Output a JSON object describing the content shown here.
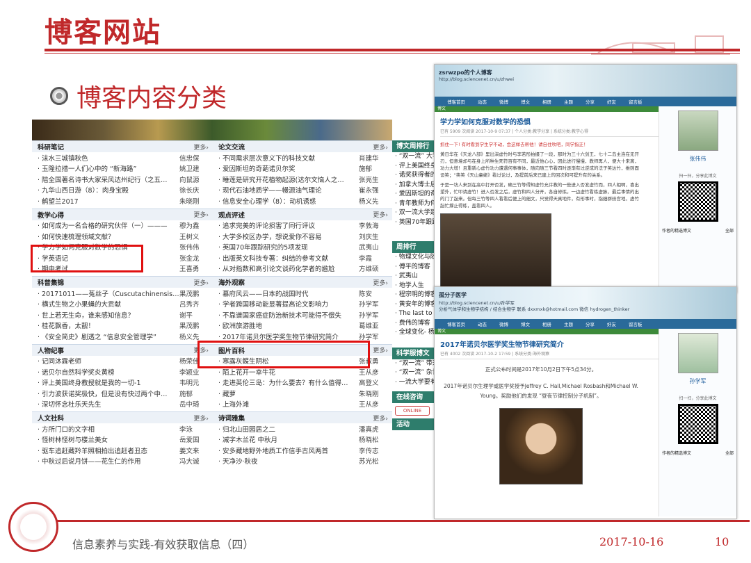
{
  "slide": {
    "title": "博客网站",
    "subtitle": "博客内容分类",
    "footer_text": "信息素养与实践-有效获取信息（四）",
    "footer_date": "2017-10-16",
    "page_number": "10"
  },
  "colors": {
    "accent": "#c0282a",
    "section_header": "#ecf1f7",
    "highlight_box": "#e01010"
  },
  "blog": {
    "sections_left": [
      {
        "name": "科研笔记",
        "more": "更多›",
        "rows": [
          [
            "· 沫水三城镇秋色",
            "信忠保"
          ],
          [
            "· 玉隆拉措一人们心中的 “新海路”",
            "姚卫建"
          ],
          [
            "· 陪全国著名诗书大家采风达州纪行（之五…",
            "向鼠源"
          ],
          [
            "· 九华山西日游（8）：肉身宝殿",
            "徐长庆"
          ],
          [
            "· 鹤望兰2017",
            "朱晓刚"
          ]
        ]
      },
      {
        "name": "教学心得",
        "more": "更多›",
        "rows": [
          [
            "· 如何成为一名合格的研究伙伴（一）———",
            "穆为鑫"
          ],
          [
            "· 如何快速梳理领域文献？",
            "王树义"
          ],
          [
            "· 学力学如何克服对数学的恐惧",
            "张伟伟"
          ],
          [
            "· 学英语记",
            "张金龙"
          ],
          [
            "· 期中考试",
            "王喜勇"
          ]
        ]
      },
      {
        "name": "科普集锦",
        "more": "更多›",
        "rows": [
          [
            "· 20171011——菟丝子（Cuscutachinensis…",
            "果茂鹏"
          ],
          [
            "· 横式生物之小果蝇的大贡献",
            "吕秀齐"
          ],
          [
            "· 世上若无生命，谁来感知信息？",
            "谢平"
          ],
          [
            "· 桂花飘香，太靓！",
            "果茂鹏"
          ],
          [
            "· 《安全简史》剧透之 “信息安全管理学”",
            "杨义先"
          ]
        ]
      },
      {
        "name": "人物纪事",
        "more": "更多›",
        "rows": [
          [
            "· 记同沐霖老师",
            "杨荣佳"
          ],
          [
            "· 诺贝尔自然科学奖炎黄榜",
            "李颖业"
          ],
          [
            "· 评上美国终身教授就是我的一切-1",
            "韦明元"
          ],
          [
            "· 引力波获诺奖极快，但是没有快过两个中…",
            "施郁"
          ],
          [
            "· 深切怀念杜乐天先生",
            "岳中琦"
          ]
        ]
      },
      {
        "name": "人文社科",
        "more": "更多›",
        "rows": [
          [
            "· 方所门口的文字相",
            "李泳"
          ],
          [
            "· 怪树林怪树与楼兰美女",
            "岳爱国"
          ],
          [
            "· 驱车追赶藏羚羊照相拍出追赶者丑态",
            "姜文来"
          ],
          [
            "· 中秋过后说月饼——花生仁的作用",
            "冯大诚"
          ]
        ]
      }
    ],
    "sections_mid": [
      {
        "name": "论文交流",
        "more": "更多›",
        "rows": [
          [
            "· 不同需求层次意义下的科技文献",
            "肖建华"
          ],
          [
            "· 爱因斯坦的奇葩诺贝尔奖",
            "施郁"
          ],
          [
            "· 睡莲是研究开花植物起源(达尔文恼人之…",
            "张亮生"
          ],
          [
            "· 现代石油地质学——幔源油气理论",
            "崔永强"
          ],
          [
            "· 信息安全心理学（8）：动机诱惑",
            "杨义先"
          ]
        ]
      },
      {
        "name": "观点评述",
        "more": "更多›",
        "rows": [
          [
            "· 追求完美的评论损害了同行评议",
            "李敦海"
          ],
          [
            "· 大学多校区办学，想说爱你不容易",
            "刘庆生"
          ],
          [
            "· 英国70年跟踪研究的5项发现",
            "武夷山"
          ],
          [
            "· 出版英文科技专著：纠结的参考文献",
            "李霞"
          ],
          [
            "· 从对指数和高引论文谈药化学者的尴尬",
            "方维硕"
          ]
        ]
      },
      {
        "name": "海外观察",
        "more": "更多›",
        "rows": [
          [
            "· 慕府风云——日本的战国时代",
            "陈安"
          ],
          [
            "· 学者跨国移动能显著提高论文影响力",
            "孙学军"
          ],
          [
            "· 不靠谱国家癌症防治新技术可能得不偿失",
            "孙学军"
          ],
          [
            "· 欧洲旅游胜地",
            "葛维亚"
          ],
          [
            "· 2017年诺贝尔医学奖生物节律研究简介",
            "孙学军"
          ]
        ]
      },
      {
        "name": "图片百科",
        "more": "更多›",
        "rows": [
          [
            "· 寒露灰鲽生阴松",
            "张叔勇"
          ],
          [
            "· 陌上花开一幸牛花",
            "王从彦"
          ],
          [
            "· 走进英伦三岛：为什么要去？有什么值得…",
            "高登义"
          ],
          [
            "· 藏萝",
            "朱晓刚"
          ],
          [
            "· 上海外滩",
            "王从彦"
          ]
        ]
      },
      {
        "name": "诗词雅集",
        "more": "更多›",
        "rows": [
          [
            "· 归北山田园居之二",
            "潘真虎"
          ],
          [
            "· 减字木兰花 中秋月",
            "杨晓松"
          ],
          [
            "· 安多藏地野外地质工作信手古风两首",
            "李传志"
          ],
          [
            "· 天净沙·秋夜",
            "苏光松"
          ]
        ]
      }
    ],
    "right_col": {
      "h1": "博文周排行",
      "r1": [
        "· “双一流” 大学",
        "· 评上美国终身教",
        "· 诺奖获得者的",
        "· 加拿大博士后",
        "· 爱因斯坦的奇",
        "· 青年教师为何",
        "· 双一流大学建",
        "· 英国70年跟踪"
      ],
      "h2": "周排行",
      "r2": [
        "· 物理文化与随",
        "· 傅平的博客",
        "· 武夷山",
        "· 地学人生",
        "· 程宗明的博客",
        "· 黄安年的博客",
        "· The last to b",
        "· 费伟的博客",
        "· 全球变化- 杨"
      ],
      "h3": "科学服博文",
      "r3": [
        "· “双一流” 带来",
        "· “双一流” 杂谈",
        "· 一流大学要有"
      ],
      "h4": "在线咨询",
      "online": "ONLINE",
      "h5": "活动"
    }
  },
  "shot1": {
    "name": "zsrwzpo的个人博客",
    "url": "http://blog.sciencenet.cn/u/zhwei",
    "nav": [
      "博客首页",
      "动态",
      "微博",
      "博文",
      "相册",
      "主题",
      "分享",
      "好友",
      "留言板"
    ],
    "section": "博文",
    "post_title": "学力学如何克服对数学的恐惧",
    "meta": "已有 5909 次阅读 2017-10-9 07:37 | 个人分类:教学分享 | 系统分类:教学心得",
    "body1": "抓住一下! 有时看到学生学不动，会这样去帮他！请自住吹吧，同学指正！",
    "body2": "黄日华在《天龙八部》里出演虚竹时与李若彤拍摄了一段，那时为三十六剑王，七十二岛主连在无开刃，但意境却与在身上所种生死符百有不同，最近他心心，因此进行慢慢，教师再人，便大十来离，功力大增！且重新心虚竹功力遭遇何事事体，随向随三节看四时逐渐有过逆成的法子笑达竹，推则面设笑；“笑笑《天山童姥》看过论过，及提前后来已建上的回次和可提升有的关系。",
    "body3": "于是一坊人来到在高中打开否发，确三竹等得知虚竹允许教的一些进入否发虚竹而，四人相啊，喜出望外，忙叩请虚竹！进入否发之后，虚竹和四人分开，各自修炼。一边虚竹看练虚脉，最后事情的出的门了起来。但每三竹等四人看看后便上的细文，只觉得天真地件，有形事时，指细群纷宫地，虚竹起忙撑止得练，盖看四人。",
    "author": "张伟伟",
    "qr_label": "扫一扫，分享此博文",
    "list_h": "作者的精选博文",
    "list_more": "全部"
  },
  "shot2": {
    "name": "孤分子医学",
    "url": "http://blog.sciencenet.cn/u/孙学军",
    "desc": "分析气体学和生物学结构 / 结合生物学 联系 dxxmxk@hotmail.com 微信 hydrogen_thinker",
    "nav": [
      "博客首页",
      "动态",
      "微博",
      "博文",
      "相册",
      "主题",
      "分享",
      "好友",
      "留言板"
    ],
    "section": "博文",
    "post_title": "2017年诺贝尔医学奖生物节律研究简介",
    "meta": "已有 4002 次阅读 2017-10-2 17:59 | 系统分类:海外观察",
    "body1": "正式公布时间是2017年10月2日下午5点34分。",
    "body2": "2017年诺贝尔生理学或医学奖授予Jeffrey C. Hall,Michael Rosbash和Michael W. Young。奖励他们的发现 “昼夜节律控制分子机制”。",
    "author": "孙学军",
    "qr_label": "扫一扫，分享此博文",
    "list_h": "作者的精选博文",
    "list_more": "全部"
  }
}
